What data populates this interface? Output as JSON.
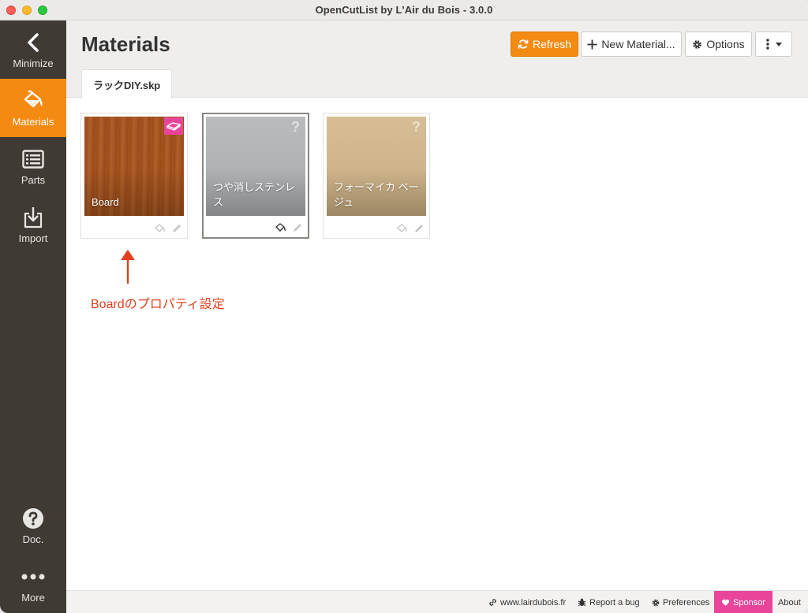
{
  "window": {
    "title": "OpenCutList by L'Air du Bois - 3.0.0"
  },
  "sidebar": {
    "items": [
      {
        "id": "minimize",
        "label": "Minimize",
        "icon": "chevron-left-icon"
      },
      {
        "id": "materials",
        "label": "Materials",
        "icon": "paint-bucket-icon",
        "active": true
      },
      {
        "id": "parts",
        "label": "Parts",
        "icon": "list-icon"
      },
      {
        "id": "import",
        "label": "Import",
        "icon": "import-icon"
      },
      {
        "id": "doc",
        "label": "Doc.",
        "icon": "question-circle-icon"
      },
      {
        "id": "more",
        "label": "More",
        "icon": "ellipsis-icon"
      }
    ]
  },
  "header": {
    "title": "Materials",
    "buttons": {
      "refresh": "Refresh",
      "new_material": "New Material...",
      "options": "Options"
    },
    "tab": "ラックDIY.skp"
  },
  "materials": [
    {
      "name": "Board",
      "color": "#a4521f",
      "badge": "sheet-good-icon",
      "selected": false
    },
    {
      "name": "つや消しステンレス",
      "color": "#b3b6b9",
      "badge": "question-icon",
      "selected": true
    },
    {
      "name": "フォーマイカ ベージュ",
      "color": "#d2b88f",
      "badge": "question-icon",
      "selected": false
    }
  ],
  "annotation": {
    "text": "Boardのプロパティ設定",
    "color": "#e0411f"
  },
  "footer": {
    "website": "www.lairdubois.fr",
    "report_bug": "Report a bug",
    "preferences": "Preferences",
    "sponsor": "Sponsor",
    "about": "About"
  },
  "colors": {
    "accent": "#f48a12",
    "sidebar": "#3f3a34",
    "sponsor": "#e8459a"
  }
}
